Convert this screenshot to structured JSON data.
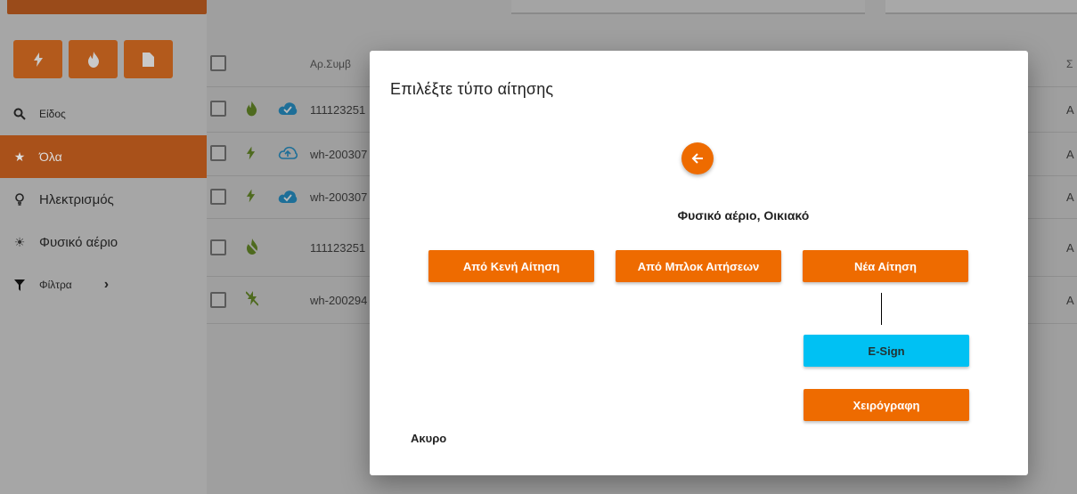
{
  "sidebar": {
    "type_buttons": [
      {
        "icon": "bolt-icon"
      },
      {
        "icon": "flame-icon"
      },
      {
        "icon": "document-icon"
      }
    ],
    "items": [
      {
        "label": "Είδος",
        "icon": "search-icon"
      },
      {
        "label": "Όλα",
        "icon": "star-icon"
      },
      {
        "label": "Ηλεκτρισμός",
        "icon": "bulb-icon"
      },
      {
        "label": "Φυσικό αέριο",
        "icon": "sun-icon"
      },
      {
        "label": "Φίλτρα",
        "icon": "filter-icon",
        "chevron": "›"
      }
    ]
  },
  "list": {
    "header": {
      "col_contract": "Αρ.Συμβ",
      "col_tail": "Σ"
    },
    "rows": [
      {
        "id": "111123251",
        "type_icon": "flame-icon",
        "cloud_icon": "cloud-check-icon",
        "tail": "A"
      },
      {
        "id": "wh-200307",
        "type_icon": "bolt-icon",
        "cloud_icon": "cloud-upload-icon",
        "tail": "A"
      },
      {
        "id": "wh-200307",
        "type_icon": "bolt-icon",
        "cloud_icon": "cloud-check-icon",
        "tail": "A"
      },
      {
        "id": "111123251",
        "type_icon": "flame-off-icon",
        "cloud_icon": "",
        "tail": "A"
      },
      {
        "id": "wh-200294",
        "type_icon": "bolt-off-icon",
        "cloud_icon": "",
        "tail": "A"
      }
    ]
  },
  "modal": {
    "title": "Επιλέξτε τύπο αίτησης",
    "subtitle": "Φυσικό αέριο, Οικιακό",
    "buttons": {
      "blank": "Από Κενή Αίτηση",
      "block": "Από Μπλοκ Αιτήσεων",
      "new": "Νέα Αίτηση",
      "esign": "E-Sign",
      "handwritten": "Χειρόγραφη"
    },
    "cancel": "Ακυρο"
  },
  "colors": {
    "accent": "#ee6b00",
    "esign": "#00c1f3",
    "overlay": "#9f9f9f"
  }
}
